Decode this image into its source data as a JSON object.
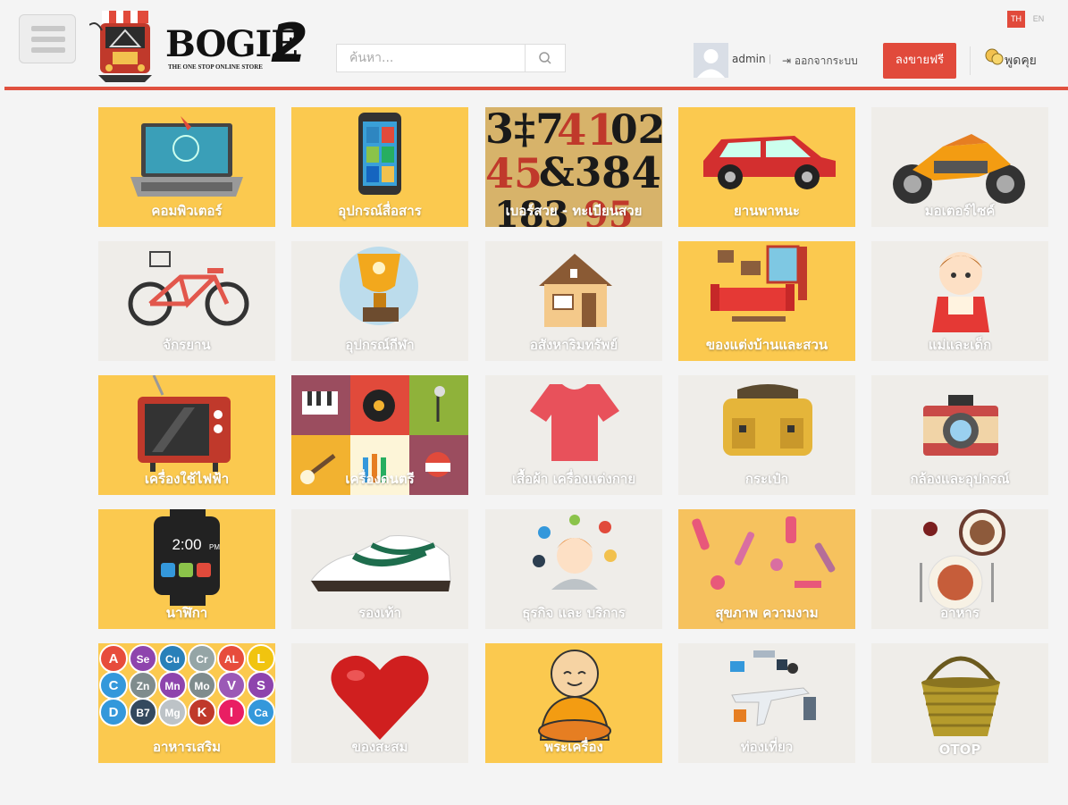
{
  "header": {
    "logo_text": "BOGIE",
    "logo_number": "2",
    "logo_tagline": "THE ONE STOP ONLINE STORE",
    "search_placeholder": "ค้นหา...",
    "user_name": "admin",
    "separator": "|",
    "logout_label": "ออกจากระบบ",
    "sell_label": "ลงขายฟรี",
    "chat_label": "พูดคุย",
    "lang_th": "TH",
    "lang_en": "EN",
    "accent_color": "#e14a3b"
  },
  "categories": [
    {
      "label": "คอมพิวเตอร์",
      "icon": "laptop-icon"
    },
    {
      "label": "อุปกรณ์สื่อสาร",
      "icon": "smartphone-icon"
    },
    {
      "label": "เบอร์สวย - ทะเบียนสวย",
      "icon": "numbers-icon"
    },
    {
      "label": "ยานพาหนะ",
      "icon": "car-icon"
    },
    {
      "label": "มอเตอร์ไซค์",
      "icon": "motorcycle-icon"
    },
    {
      "label": "จักรยาน",
      "icon": "bicycle-icon"
    },
    {
      "label": "อุปกรณ์กีฬา",
      "icon": "trophy-icon"
    },
    {
      "label": "อสังหาริมทรัพย์",
      "icon": "house-icon"
    },
    {
      "label": "ของแต่งบ้านและสวน",
      "icon": "living-room-icon"
    },
    {
      "label": "แม่และเด็ก",
      "icon": "baby-icon"
    },
    {
      "label": "เครื่องใช้ไฟฟ้า",
      "icon": "tv-icon"
    },
    {
      "label": "เครื่องดนตรี",
      "icon": "music-instruments-icon"
    },
    {
      "label": "เสื้อผ้า เครื่องแต่งกาย",
      "icon": "tshirt-icon"
    },
    {
      "label": "กระเป๋า",
      "icon": "bag-icon"
    },
    {
      "label": "กล้องและอุปกรณ์",
      "icon": "camera-icon"
    },
    {
      "label": "นาฬิกา",
      "icon": "smartwatch-icon"
    },
    {
      "label": "รองเท้า",
      "icon": "sneaker-icon"
    },
    {
      "label": "ธุรกิจ และ บริการ",
      "icon": "business-icon"
    },
    {
      "label": "สุขภาพ ความงาม",
      "icon": "cosmetics-icon"
    },
    {
      "label": "อาหาร",
      "icon": "food-icon"
    },
    {
      "label": "อาหารเสริม",
      "icon": "supplements-icon"
    },
    {
      "label": "ของสะสม",
      "icon": "heart-icon"
    },
    {
      "label": "พระเครื่อง",
      "icon": "monk-icon"
    },
    {
      "label": "ท่องเที่ยว",
      "icon": "travel-icon"
    },
    {
      "label": "OTOP",
      "icon": "basket-icon"
    }
  ],
  "watch_time": "2:00",
  "watch_ampm": "PM",
  "elements": [
    "A",
    "Se",
    "Cu",
    "Cr",
    "AL",
    "L",
    "C",
    "Zn",
    "Mn",
    "Mo",
    "V",
    "S",
    "D",
    "B7",
    "Mg",
    "K",
    "I",
    "Ca"
  ]
}
